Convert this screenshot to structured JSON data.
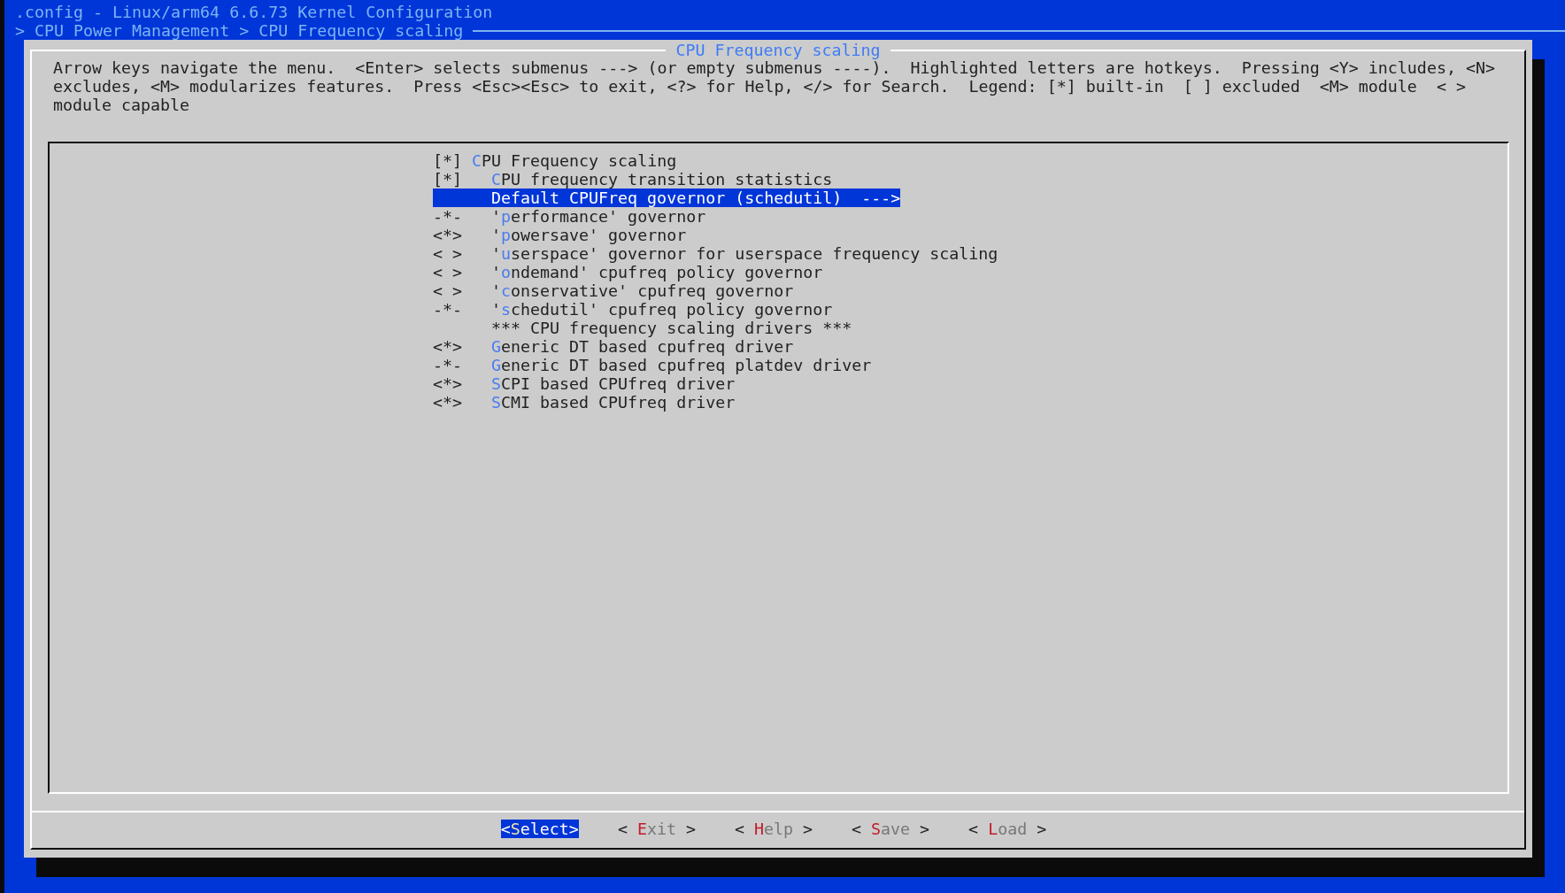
{
  "window": {
    "title": ".config - Linux/arm64 6.6.73 Kernel Configuration"
  },
  "breadcrumb": "> CPU Power Management > CPU Frequency scaling",
  "dialog": {
    "title": "CPU Frequency scaling",
    "help_text": "Arrow keys navigate the menu.  <Enter> selects submenus ---> (or empty submenus ----).  Highlighted letters are hotkeys.  Pressing <Y> includes, <N> excludes, <M> modularizes features.  Press <Esc><Esc> to exit, <?> for Help, </> for Search.  Legend: [*] built-in  [ ] excluded  <M> module  < > module capable",
    "menu": [
      {
        "kind": "option",
        "prefix": "[*]",
        "hotkey": "C",
        "rest": "PU Frequency scaling",
        "selected": false,
        "children": [
          {
            "kind": "option",
            "prefix": "[*]",
            "hotkey": "C",
            "rest": "PU frequency transition statistics",
            "selected": false
          },
          {
            "kind": "submenu",
            "rest": "Default CPUFreq governor (schedutil)",
            "arrow": "--->",
            "selected": true
          },
          {
            "kind": "option",
            "prefix": "-*-",
            "lead": "'",
            "hotkey": "p",
            "rest": "erformance' governor",
            "selected": false
          },
          {
            "kind": "option",
            "prefix": "<*>",
            "lead": "'",
            "hotkey": "p",
            "rest": "owersave' governor",
            "selected": false
          },
          {
            "kind": "option",
            "prefix": "< >",
            "lead": "'",
            "hotkey": "u",
            "rest": "serspace' governor for userspace frequency scaling",
            "selected": false
          },
          {
            "kind": "option",
            "prefix": "< >",
            "lead": "'",
            "hotkey": "o",
            "rest": "ndemand' cpufreq policy governor",
            "selected": false
          },
          {
            "kind": "option",
            "prefix": "< >",
            "lead": "'",
            "hotkey": "c",
            "rest": "onservative' cpufreq governor",
            "selected": false
          },
          {
            "kind": "option",
            "prefix": "-*-",
            "lead": "'",
            "hotkey": "s",
            "rest": "chedutil' cpufreq policy governor",
            "selected": false
          },
          {
            "kind": "comment",
            "rest": "*** CPU frequency scaling drivers ***",
            "selected": false
          },
          {
            "kind": "option",
            "prefix": "<*>",
            "hotkey": "G",
            "rest": "eneric DT based cpufreq driver",
            "selected": false
          },
          {
            "kind": "option",
            "prefix": "-*-",
            "hotkey": "G",
            "rest": "eneric DT based cpufreq platdev driver",
            "selected": false
          },
          {
            "kind": "option",
            "prefix": "<*>",
            "hotkey": "S",
            "rest": "CPI based CPUfreq driver",
            "selected": false
          },
          {
            "kind": "option",
            "prefix": "<*>",
            "hotkey": "S",
            "rest": "CMI based CPUfreq driver",
            "selected": false
          }
        ]
      }
    ],
    "buttons": [
      {
        "left": "<",
        "hotkey": "S",
        "rest": "elect",
        "right": ">",
        "selected": true
      },
      {
        "left": "<",
        "hotkey": "E",
        "rest": "xit",
        "right": ">",
        "selected": false
      },
      {
        "left": "<",
        "hotkey": "H",
        "rest": "elp",
        "right": ">",
        "selected": false
      },
      {
        "left": "<",
        "hotkey": "S",
        "rest": "ave",
        "right": ">",
        "selected": false
      },
      {
        "left": "<",
        "hotkey": "L",
        "rest": "oad",
        "right": ">",
        "selected": false
      }
    ]
  }
}
